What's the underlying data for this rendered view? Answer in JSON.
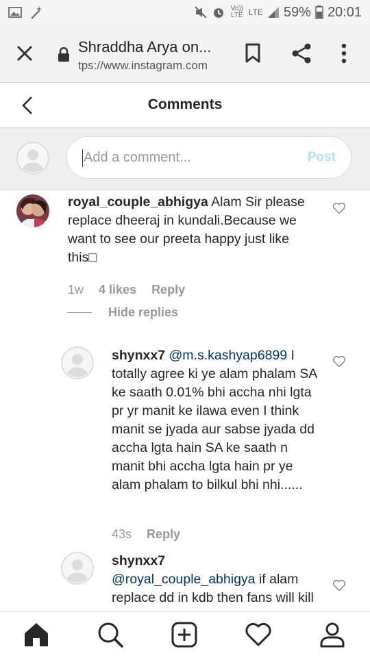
{
  "status_bar": {
    "battery": "59%",
    "time": "20:01",
    "volte": "Vo)) LTE",
    "lte": "LTE"
  },
  "browser": {
    "title": "Shraddha Arya on...",
    "url": "tps://www.instagram.com"
  },
  "header": {
    "title": "Comments"
  },
  "add_comment": {
    "placeholder": "Add a comment...",
    "post_label": "Post"
  },
  "comments": [
    {
      "username": "royal_couple_abhigya",
      "text": " Alam Sir please replace dheeraj in kundali.Because we want to see our preeta happy just like this□",
      "time": "1w",
      "likes": "4 likes",
      "reply": "Reply"
    }
  ],
  "hide_replies": "Hide replies",
  "replies": [
    {
      "username": "shynxx7",
      "mention": "@m.s.kashyap6899",
      "text": " I totally agree ki ye alam phalam SA ke saath 0.01% bhi accha nhi lgta pr yr manit ke ilawa even I think manit se jyada aur sabse jyada dd accha lgta hain SA ke saath n manit bhi accha lgta hain pr ye alam phalam to bilkul bhi nhi......",
      "time": "43s",
      "reply": "Reply"
    },
    {
      "username": "shynxx7",
      "mention": "@royal_couple_abhigya",
      "text": " if alam replace dd in kdb then fans will kill alam as well as ekta"
    }
  ],
  "icons": {
    "close": "close-icon",
    "lock": "lock-icon",
    "bookmark": "bookmark-icon",
    "share": "share-icon",
    "more": "more-vertical-icon",
    "back": "chevron-left-icon",
    "heart": "heart-outline-icon",
    "home": "home-icon",
    "search": "search-icon",
    "add": "add-post-icon",
    "activity": "heart-icon",
    "profile": "profile-icon"
  },
  "colors": {
    "mention": "#003569",
    "post_disabled": "#b2dffc",
    "meta_gray": "#999999"
  }
}
